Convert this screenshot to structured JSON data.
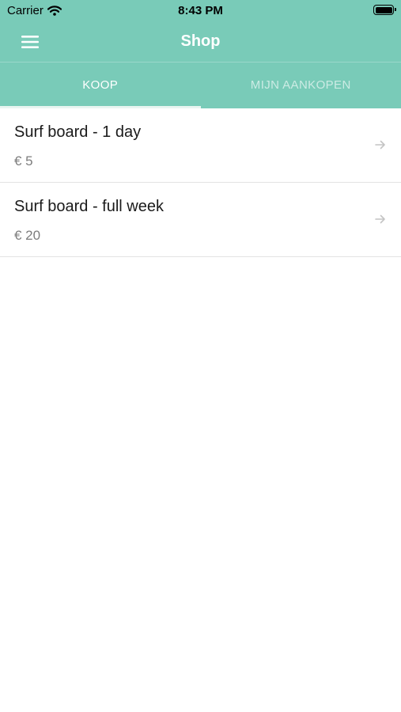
{
  "status_bar": {
    "carrier": "Carrier",
    "time": "8:43 PM"
  },
  "nav": {
    "title": "Shop",
    "menu_icon": "hamburger-menu-icon"
  },
  "tabs": [
    {
      "label": "KOOP",
      "active": true
    },
    {
      "label": "MIJN AANKOPEN",
      "active": false
    }
  ],
  "products": [
    {
      "name": "Surf board - 1 day",
      "price": "€ 5",
      "icon": "arrow-right-icon"
    },
    {
      "name": "Surf board - full week",
      "price": "€ 20",
      "icon": "arrow-right-icon"
    }
  ],
  "colors": {
    "header": "#79cbb8",
    "text": "#1a1a1a",
    "price": "#7d7d7d"
  }
}
